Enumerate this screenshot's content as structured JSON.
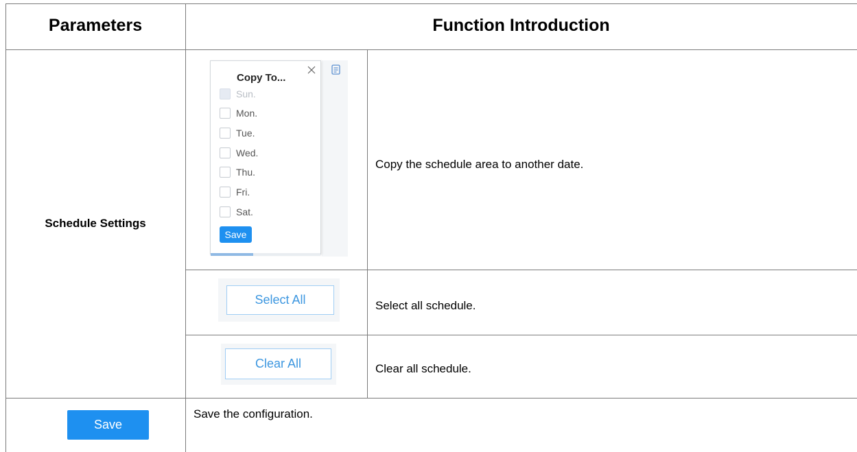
{
  "table": {
    "headers": {
      "parameters": "Parameters",
      "function_intro": "Function Introduction"
    },
    "rows": {
      "schedule": {
        "param_label": "Schedule Settings",
        "copy_desc": "Copy the schedule area to another date.",
        "select_all_desc": "Select all schedule.",
        "clear_all_desc": "Clear all schedule."
      },
      "save": {
        "desc": "Save the configuration."
      }
    }
  },
  "copy_to_popup": {
    "title": "Copy To...",
    "close_icon": "close-icon",
    "side_icon": "document-icon",
    "days": [
      {
        "label": "Sun.",
        "disabled": true
      },
      {
        "label": "Mon.",
        "disabled": false
      },
      {
        "label": "Tue.",
        "disabled": false
      },
      {
        "label": "Wed.",
        "disabled": false
      },
      {
        "label": "Thu.",
        "disabled": false
      },
      {
        "label": "Fri.",
        "disabled": false
      },
      {
        "label": "Sat.",
        "disabled": false
      }
    ],
    "save_label": "Save"
  },
  "buttons": {
    "select_all": "Select All",
    "clear_all": "Clear All",
    "save": "Save"
  },
  "colors": {
    "primary": "#1e90f0",
    "outline_border": "#9fcdf4",
    "outline_text": "#3d97e0",
    "grid_line": "#7a7a7a"
  }
}
